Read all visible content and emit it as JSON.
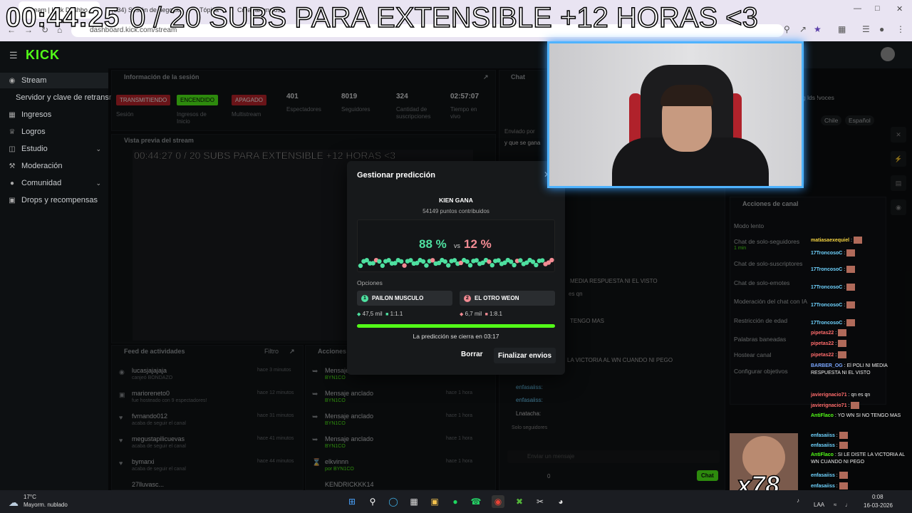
{
  "browser": {
    "tabs": [
      "Stream | Kick Dashbo...",
      "(534) Sesión de negocio",
      "Tópica",
      "Crear anuncios"
    ],
    "url": "dashboard.kick.com/stream"
  },
  "overlay": {
    "timer": "00:44:25",
    "text": "0 / 20 SUBS PARA EXTENSIBLE +12 HORAS <3"
  },
  "app": {
    "logo": "KICK"
  },
  "sidebar": {
    "items": [
      {
        "label": "Stream",
        "icon": "stream-icon"
      },
      {
        "label": "Servidor y clave de retransmisión",
        "icon": ""
      },
      {
        "label": "Ingresos",
        "icon": "money-icon"
      },
      {
        "label": "Logros",
        "icon": "trophy-icon"
      },
      {
        "label": "Estudio",
        "icon": "studio-icon"
      },
      {
        "label": "Moderación",
        "icon": "wrench-icon"
      },
      {
        "label": "Comunidad",
        "icon": "people-icon"
      },
      {
        "label": "Drops y recompensas",
        "icon": "gift-icon"
      }
    ]
  },
  "session": {
    "title": "Información de la sesión",
    "stats": [
      {
        "badge": "TRANSMITIENDO",
        "label": "Sesión"
      },
      {
        "badge": "ENCENDIDO",
        "label": "Ingresos de Inicio"
      },
      {
        "badge": "APAGADO",
        "label": "Multistream"
      },
      {
        "value": "401",
        "label": "Espectadores"
      },
      {
        "value": "8019",
        "label": "Seguidores"
      },
      {
        "value": "324",
        "label": "Cantidad de suscripciones"
      },
      {
        "value": "02:57:07",
        "label": "Tiempo en vivo"
      }
    ]
  },
  "preview": {
    "title": "Vista previa del stream",
    "overlay_text": "00:44:27 0 / 20 SUBS PARA EXTENSIBLE +12 HORAS <3"
  },
  "feed": {
    "title": "Feed de actividades",
    "filter": "Filtro",
    "items": [
      {
        "name": "lucasjajajaja",
        "sub": "canjeó BONDAZO",
        "time": "hace 3 minutos"
      },
      {
        "name": "marioreneto0",
        "sub": "fue hosteado con 9 espectadores!",
        "time": "hace 12 minutos"
      },
      {
        "name": "fvrnando012",
        "sub": "acaba de seguir el canal",
        "time": "hace 31 minutos"
      },
      {
        "name": "megustapilicuevas",
        "sub": "acaba de seguir el canal",
        "time": "hace 41 minutos"
      },
      {
        "name": "bymarxi",
        "sub": "acaba de seguir el canal",
        "time": "hace 44 minutos"
      },
      {
        "name": "27lluvasc...",
        "sub": "",
        "time": ""
      }
    ]
  },
  "actions": {
    "title": "Acciones",
    "items": [
      {
        "name": "Mensaje...",
        "sub": "BYN1CO",
        "time": ""
      },
      {
        "name": "Mensaje anclado",
        "sub": "BYN1CO",
        "time": "hace 1 hora"
      },
      {
        "name": "Mensaje anclado",
        "sub": "BYN1CO",
        "time": "hace 1 hora"
      },
      {
        "name": "Mensaje anclado",
        "sub": "BYN1CO",
        "time": "hace 1 hora"
      },
      {
        "name": "elkvinnn",
        "sub": "por BYN1CO",
        "time": "hace 1 hora"
      },
      {
        "name": "KENDRICKKK14",
        "sub": "",
        "time": ""
      }
    ]
  },
  "chat_panel": {
    "title": "Chat",
    "sent_by": "Enviado por",
    "line1": "y que se gana",
    "msgs": [
      "MEDIA RESPUESTA NI EL VISTO",
      "es qn",
      "TENGO MAS",
      "LA VICTORIA AL WN CUANDO NI PEGO"
    ],
    "users_left": [
      "enfasaiiss:",
      "enfasaiiss:",
      "Lnatacha:"
    ],
    "followers_only": "Solo seguidores",
    "input_placeholder": "Enviar un mensaje",
    "count": "0",
    "send": "Chat"
  },
  "channel_actions": {
    "title": "Acciones de canal",
    "items": [
      "Modo lento",
      "Chat de solo-seguidores",
      "Chat de solo-suscriptores",
      "Chat de solo-emotes",
      "Moderación del chat con IA",
      "Restricción de edad",
      "Palabras baneadas",
      "Hostear canal",
      "Configurar objetivos"
    ],
    "min_label": "1 min",
    "tags": [
      "Chile",
      "Español"
    ],
    "title_text": "g lds !voces"
  },
  "chat": [
    {
      "user": "matiasaexequiel",
      "color": "u-yellow",
      "text": ""
    },
    {
      "user": "17TroncosoC",
      "color": "u-teal",
      "text": ""
    },
    {
      "user": "17TroncosoC",
      "color": "u-teal",
      "text": ""
    },
    {
      "user": "17TroncosoC",
      "color": "u-teal",
      "text": ""
    },
    {
      "user": "17TroncosoC",
      "color": "u-teal",
      "text": ""
    },
    {
      "user": "17TroncosoC",
      "color": "u-teal",
      "text": ""
    },
    {
      "user": "pipetas22",
      "color": "u-red",
      "text": ""
    },
    {
      "user": "pipetas22",
      "color": "u-red",
      "text": ""
    },
    {
      "user": "pipetas22",
      "color": "u-red",
      "text": ""
    },
    {
      "user": "BARBER_OG",
      "color": "u-blue",
      "text": "El POLI NI MEDIA RESPUESTA NI EL VISTO"
    },
    {
      "user": "javierignacio71",
      "color": "u-red",
      "text": "qn es qn"
    },
    {
      "user": "javierignacio71",
      "color": "u-red",
      "text": ""
    },
    {
      "user": "AntiFlaco",
      "color": "u-green",
      "text": "YO WN SI NO TENGO MAS"
    },
    {
      "user": "enfasaiiss",
      "color": "u-teal",
      "text": ""
    },
    {
      "user": "enfasaiiss",
      "color": "u-teal",
      "text": ""
    },
    {
      "user": "AntiFlaco",
      "color": "u-green",
      "text": "SI LE DISTE LA VICTORIA AL WN CUANDO NI PEGO"
    },
    {
      "user": "enfasaiiss",
      "color": "u-teal",
      "text": ""
    },
    {
      "user": "enfasaiiss",
      "color": "u-teal",
      "text": ""
    },
    {
      "user": "enfasaiiss",
      "color": "u-teal",
      "text": ""
    }
  ],
  "emote_overlay": {
    "count": "x78"
  },
  "prediction": {
    "title": "Gestionar predicción",
    "question": "KIEN GANA",
    "points": "54149 puntos contribuidos",
    "pct_a": "88 %",
    "vs": "vs",
    "pct_b": "12 %",
    "options_label": "Opciones",
    "options": [
      {
        "num": "1",
        "label": "PAILON MUSCULO",
        "points": "47,5 mil",
        "ratio": "1:1.1",
        "color": "#4ee0a0"
      },
      {
        "num": "2",
        "label": "EL OTRO WEON",
        "points": "6,7 mil",
        "ratio": "1:8.1",
        "color": "#f28b93"
      }
    ],
    "timer_label": "La predicción se cierra en",
    "timer_value": "03:17",
    "progress": 1.0,
    "clear": "Borrar",
    "finish": "Finalizar envios"
  },
  "taskbar": {
    "temp": "17°C",
    "weather": "Mayorm. nublado",
    "lang": "LAA",
    "time": "0:08",
    "date": "16-03-2026"
  }
}
